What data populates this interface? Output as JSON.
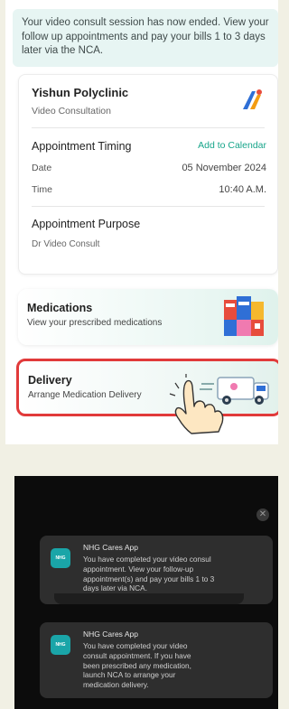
{
  "notice": {
    "text": "Your video consult session has now ended. View your follow up appointments and pay your bills 1 to 3 days later via the NCA."
  },
  "appointment": {
    "clinic_name": "Yishun Polyclinic",
    "consult_type": "Video Consultation",
    "timing_title": "Appointment Timing",
    "add_to_calendar": "Add to Calendar",
    "date_label": "Date",
    "date_value": "05 November 2024",
    "time_label": "Time",
    "time_value": "10:40 A.M.",
    "purpose_title": "Appointment Purpose",
    "purpose_value": "Dr Video Consult"
  },
  "medications": {
    "title": "Medications",
    "subtitle": "View your prescribed medications"
  },
  "delivery": {
    "title": "Delivery",
    "subtitle": "Arrange Medication Delivery",
    "highlight_color": "#e13a3a"
  },
  "notifications": [
    {
      "icon_text": "NHG CARES",
      "app": "NHG Cares App",
      "body": "You have completed your video consul\nappointment. View your follow-up\nappointment(s) and pay your bills 1 to 3\ndays later via NCA."
    },
    {
      "icon_text": "NHG CARES",
      "app": "NHG Cares App",
      "body": "You have completed your video\nconsult appointment. If you have\nbeen prescribed any medication,\nlaunch NCA to arrange your\nmedication delivery."
    }
  ],
  "colors": {
    "accent": "#17a58a",
    "notice_bg": "#e7f5f3",
    "app_icon": "#1aa5a8"
  }
}
